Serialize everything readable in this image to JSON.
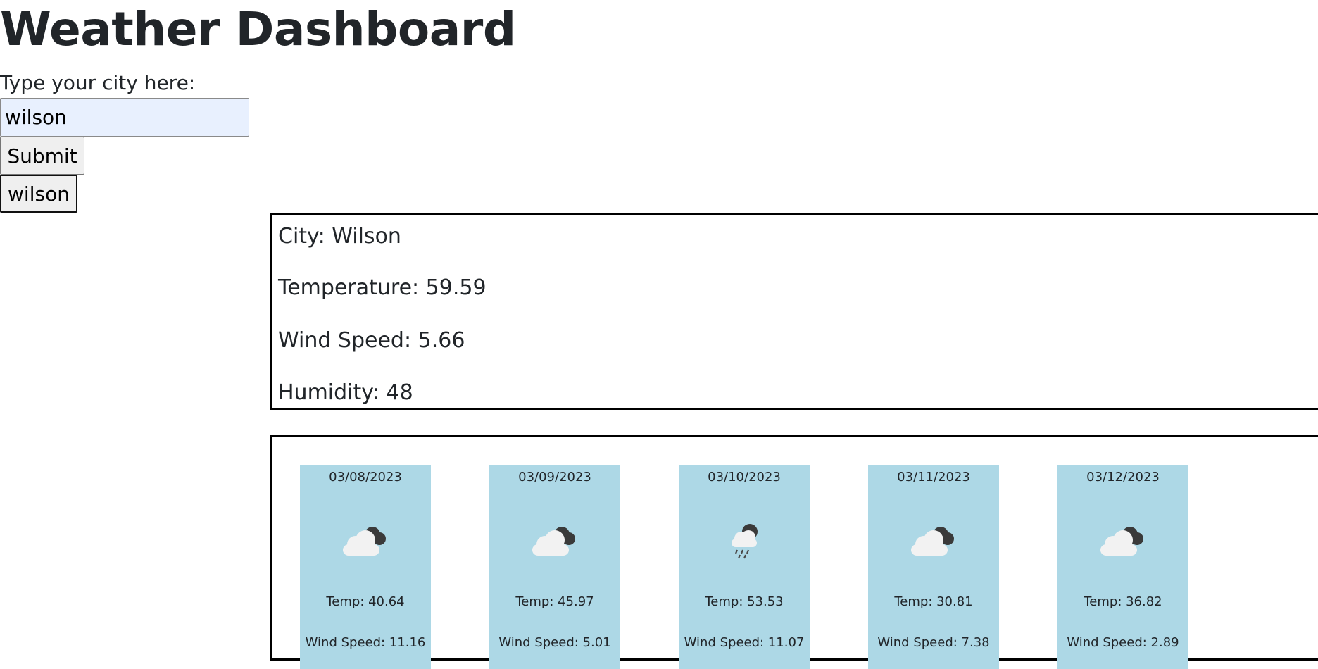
{
  "header": {
    "title": "Weather Dashboard"
  },
  "search": {
    "label": "Type your city here:",
    "value": "wilson",
    "submit_label": "Submit"
  },
  "history": {
    "items": [
      "wilson"
    ]
  },
  "current": {
    "city": "City: Wilson",
    "temperature": "Temperature: 59.59",
    "wind_speed": "Wind Speed: 5.66",
    "humidity": "Humidity: 48"
  },
  "forecast": [
    {
      "date": "03/08/2023",
      "icon": "cloudy-icon",
      "temp": "Temp: 40.64",
      "wind": "Wind Speed: 11.16"
    },
    {
      "date": "03/09/2023",
      "icon": "cloudy-icon",
      "temp": "Temp: 45.97",
      "wind": "Wind Speed: 5.01"
    },
    {
      "date": "03/10/2023",
      "icon": "rain-icon",
      "temp": "Temp: 53.53",
      "wind": "Wind Speed: 11.07"
    },
    {
      "date": "03/11/2023",
      "icon": "cloudy-icon",
      "temp": "Temp: 30.81",
      "wind": "Wind Speed: 7.38"
    },
    {
      "date": "03/12/2023",
      "icon": "cloudy-icon",
      "temp": "Temp: 36.82",
      "wind": "Wind Speed: 2.89"
    }
  ],
  "colors": {
    "card_background": "#add8e6",
    "input_background": "#e8f0fe",
    "text": "#212529"
  }
}
